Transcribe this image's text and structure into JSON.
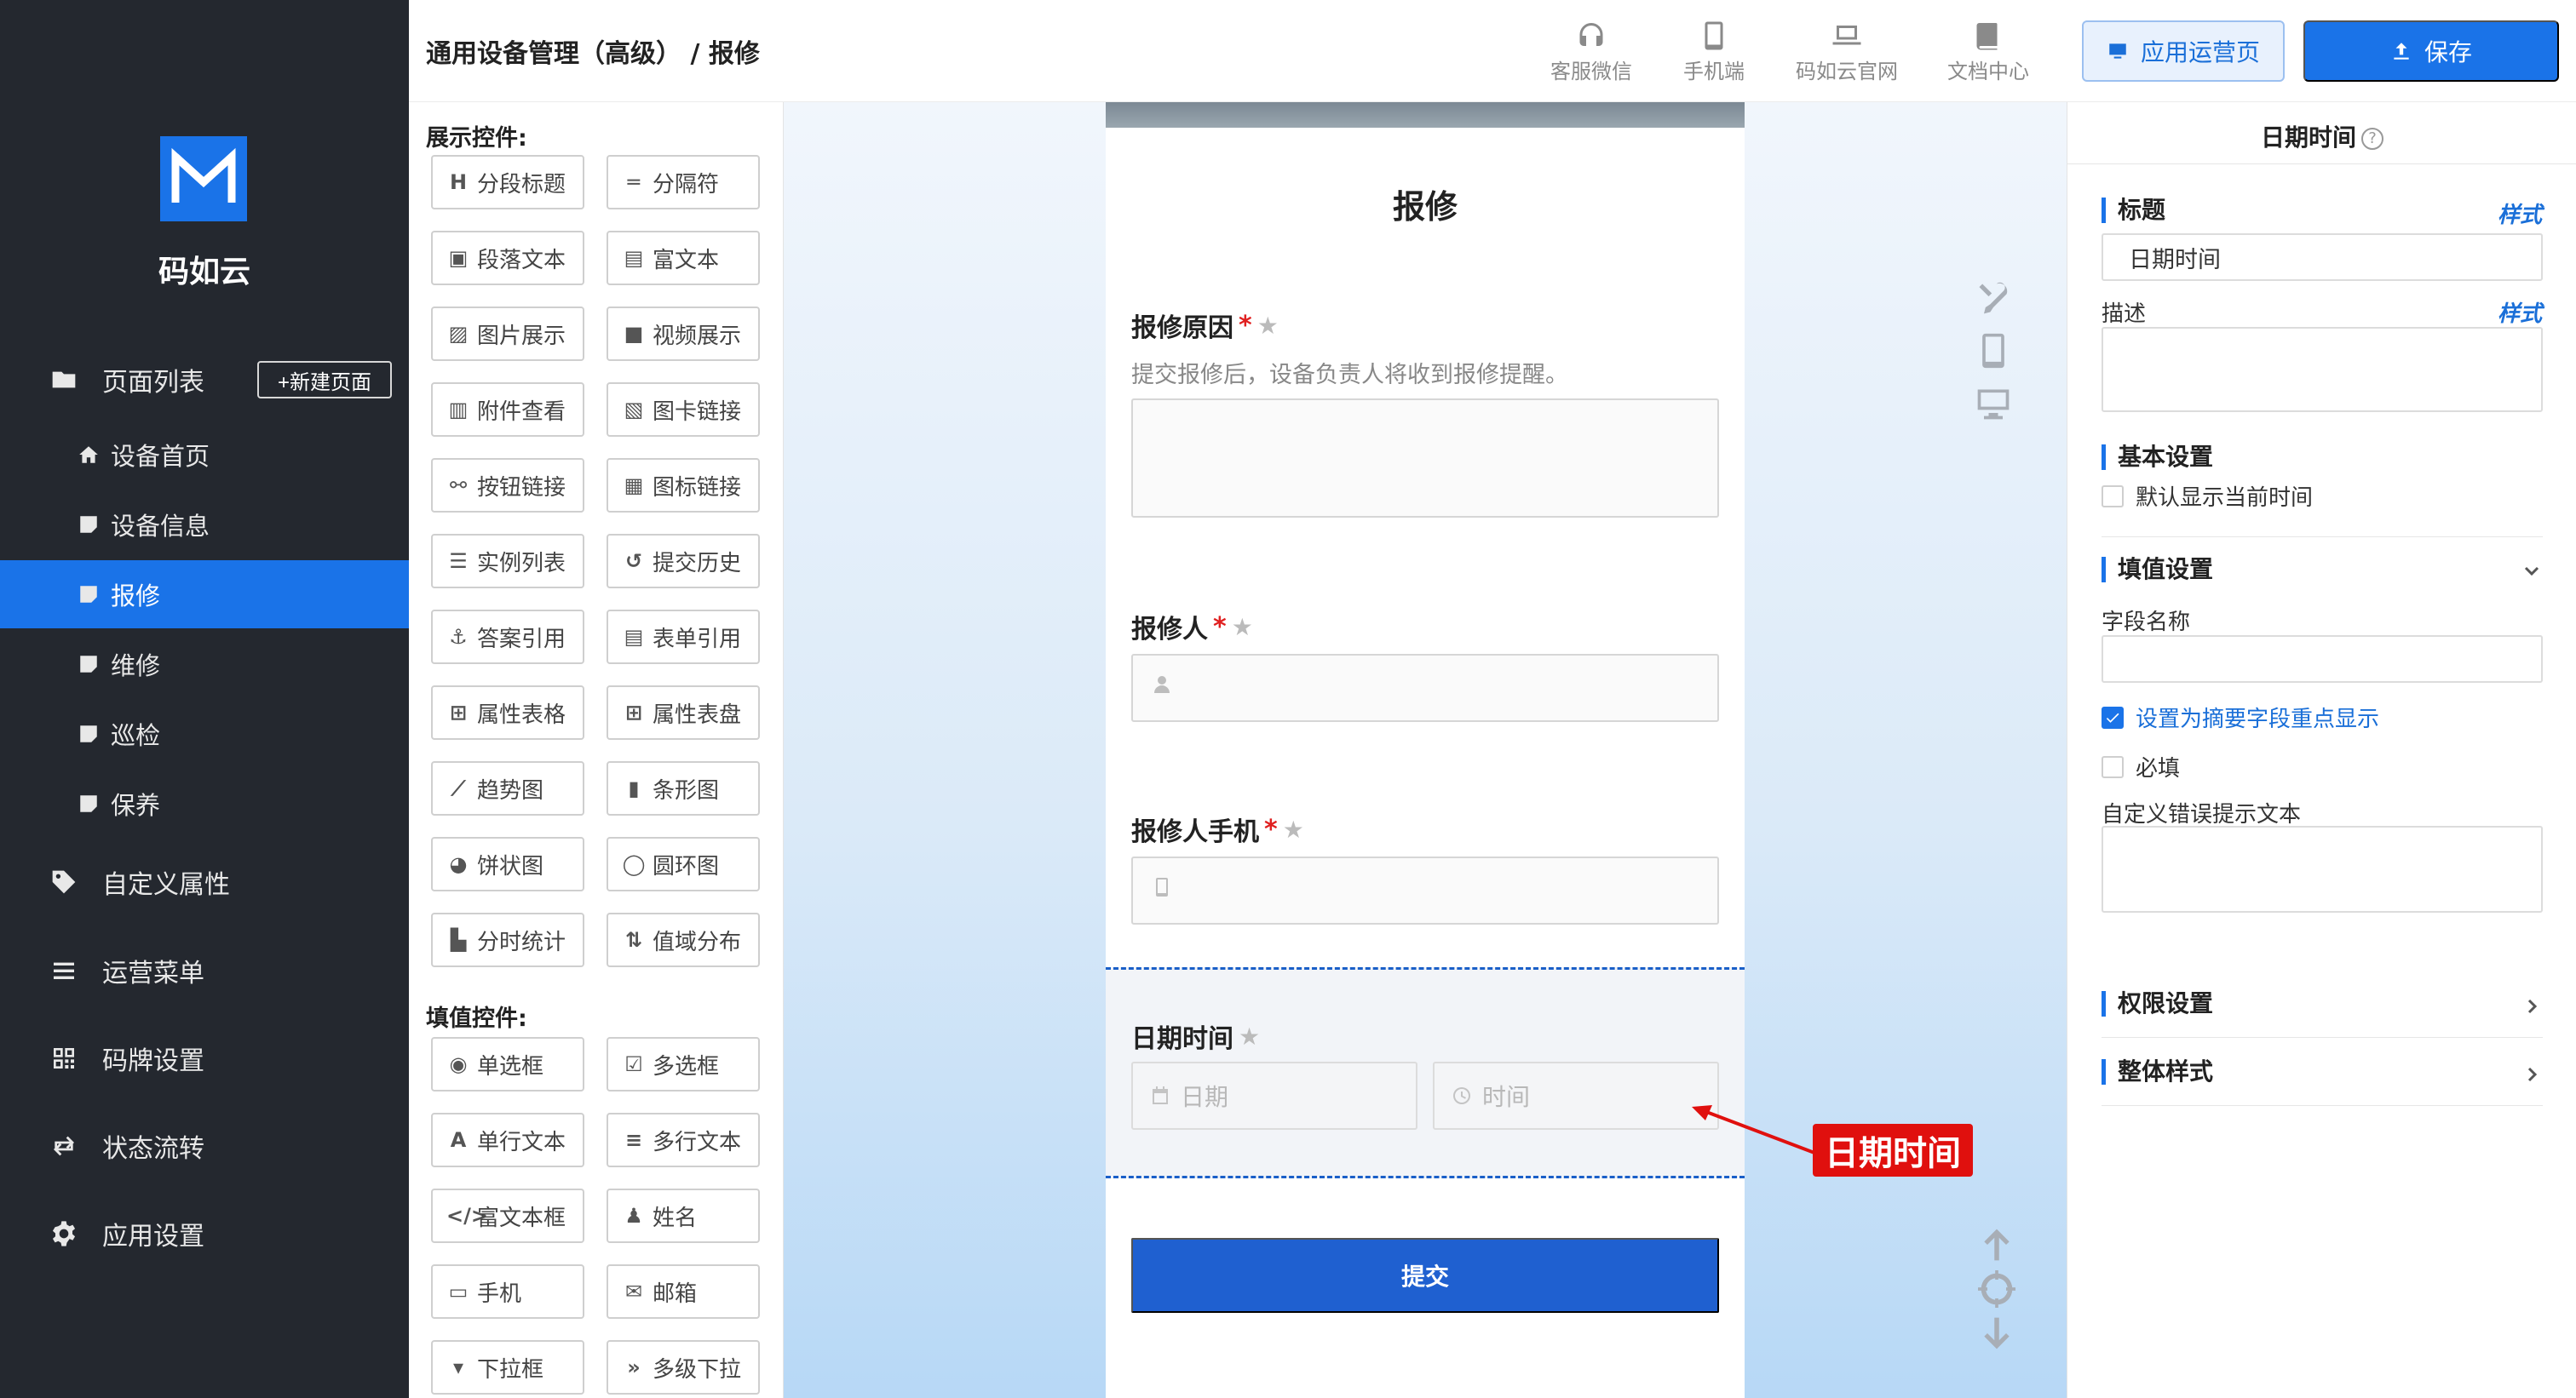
{
  "sidebar": {
    "brand": "码如云",
    "page_list": "页面列表",
    "new_page": "+新建页面",
    "pages": [
      {
        "label": "设备首页",
        "icon": "home-icon"
      },
      {
        "label": "设备信息",
        "icon": "page-icon"
      },
      {
        "label": "报修",
        "icon": "page-icon",
        "active": true
      },
      {
        "label": "维修",
        "icon": "page-icon"
      },
      {
        "label": "巡检",
        "icon": "page-icon"
      },
      {
        "label": "保养",
        "icon": "page-icon"
      }
    ],
    "menu": [
      {
        "label": "自定义属性",
        "icon": "tag-icon"
      },
      {
        "label": "运营菜单",
        "icon": "menu-icon"
      },
      {
        "label": "码牌设置",
        "icon": "qrcode-icon"
      },
      {
        "label": "状态流转",
        "icon": "flow-icon"
      },
      {
        "label": "应用设置",
        "icon": "gear-icon"
      }
    ]
  },
  "header": {
    "breadcrumb": "通用设备管理（高级） / 报修",
    "links": [
      {
        "label": "客服微信",
        "icon": "headset-icon"
      },
      {
        "label": "手机端",
        "icon": "phone-icon"
      },
      {
        "label": "码如云官网",
        "icon": "laptop-icon"
      },
      {
        "label": "文档中心",
        "icon": "book-icon"
      }
    ],
    "ops_button": "应用运营页",
    "save_button": "保存"
  },
  "palette": {
    "display_title": "展示控件:",
    "display_widgets": [
      {
        "label": "分段标题",
        "icon": "H"
      },
      {
        "label": "分隔符",
        "icon": "═"
      },
      {
        "label": "段落文本",
        "icon": "▣"
      },
      {
        "label": "富文本",
        "icon": "▤"
      },
      {
        "label": "图片展示",
        "icon": "▨"
      },
      {
        "label": "视频展示",
        "icon": "■"
      },
      {
        "label": "附件查看",
        "icon": "▥"
      },
      {
        "label": "图卡链接",
        "icon": "▧"
      },
      {
        "label": "按钮链接",
        "icon": "⚯"
      },
      {
        "label": "图标链接",
        "icon": "▦"
      },
      {
        "label": "实例列表",
        "icon": "☰"
      },
      {
        "label": "提交历史",
        "icon": "↺"
      },
      {
        "label": "答案引用",
        "icon": "⚓"
      },
      {
        "label": "表单引用",
        "icon": "▤"
      },
      {
        "label": "属性表格",
        "icon": "⊞"
      },
      {
        "label": "属性表盘",
        "icon": "⊞"
      },
      {
        "label": "趋势图",
        "icon": "⟋"
      },
      {
        "label": "条形图",
        "icon": "▮"
      },
      {
        "label": "饼状图",
        "icon": "◕"
      },
      {
        "label": "圆环图",
        "icon": "◯"
      },
      {
        "label": "分时统计",
        "icon": "▙"
      },
      {
        "label": "值域分布",
        "icon": "⇅"
      }
    ],
    "input_title": "填值控件:",
    "input_widgets": [
      {
        "label": "单选框",
        "icon": "◉"
      },
      {
        "label": "多选框",
        "icon": "☑"
      },
      {
        "label": "单行文本",
        "icon": "A"
      },
      {
        "label": "多行文本",
        "icon": "≡"
      },
      {
        "label": "富文本框",
        "icon": "</>"
      },
      {
        "label": "姓名",
        "icon": "♟"
      },
      {
        "label": "手机",
        "icon": "▭"
      },
      {
        "label": "邮箱",
        "icon": "✉"
      },
      {
        "label": "下拉框",
        "icon": "▾"
      },
      {
        "label": "多级下拉",
        "icon": "»"
      }
    ]
  },
  "form": {
    "title": "报修",
    "fields": {
      "reason_label": "报修原因",
      "reason_desc": "提交报修后，设备负责人将收到报修提醒。",
      "reporter_label": "报修人",
      "phone_label": "报修人手机",
      "datetime_label": "日期时间",
      "date_placeholder": "日期",
      "time_placeholder": "时间"
    },
    "required_mark": "*",
    "star": "★",
    "submit": "提交"
  },
  "callout": "日期时间",
  "props": {
    "header": "日期时间",
    "help": "?",
    "title_label": "标题",
    "style_link": "样式",
    "title_value": "日期时间",
    "desc_label": "描述",
    "basic_settings": "基本设置",
    "default_now": "默认显示当前时间",
    "fill_settings": "填值设置",
    "field_name": "字段名称",
    "summary_key": "设置为摘要字段重点显示",
    "summary_checked": true,
    "required": "必填",
    "required_checked": false,
    "custom_error": "自定义错误提示文本",
    "permission_settings": "权限设置",
    "overall_style": "整体样式"
  },
  "colors": {
    "sidebar_bg": "#24282f",
    "accent": "#1a73e8",
    "callout": "#e0100e"
  }
}
